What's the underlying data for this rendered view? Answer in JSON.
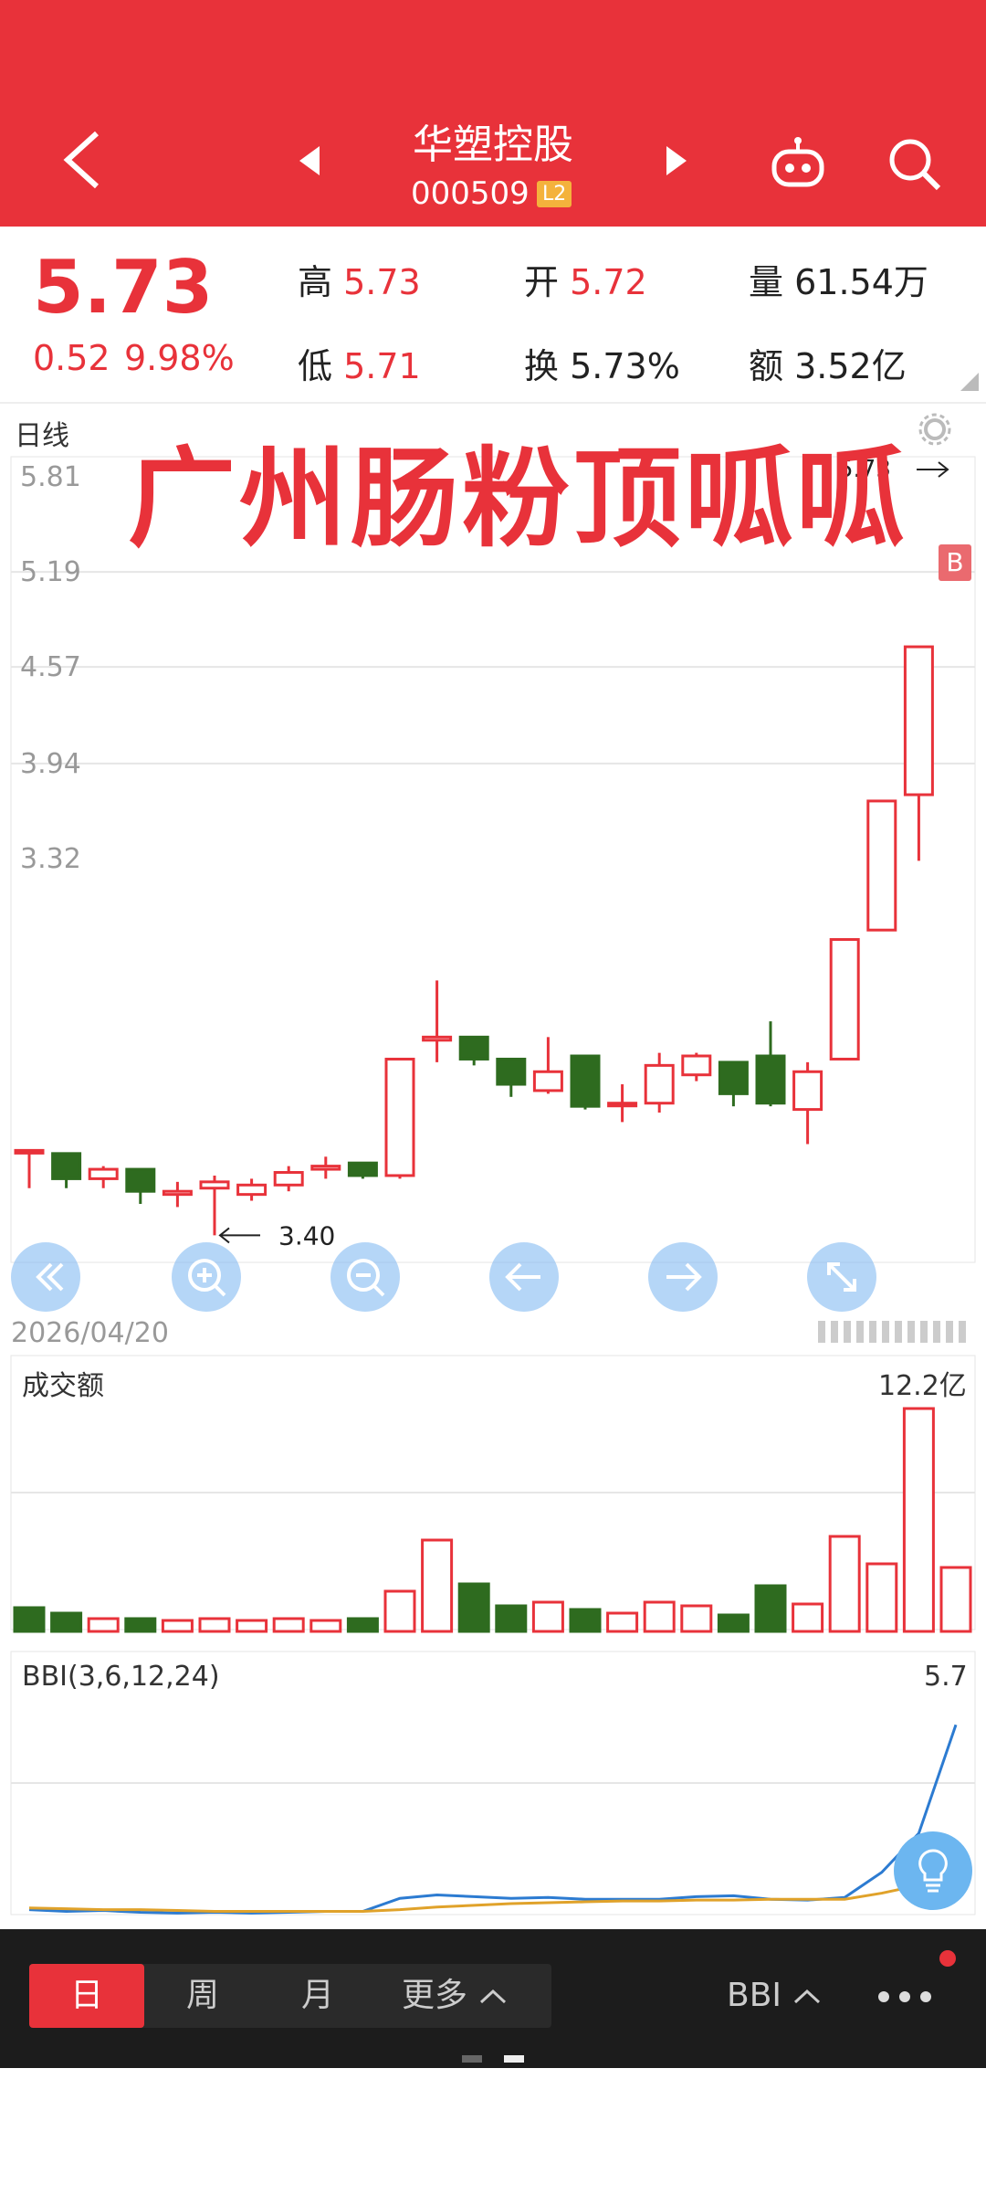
{
  "header": {
    "stock_name": "华塑控股",
    "stock_code": "000509",
    "level_badge": "L2",
    "icons": [
      "back-icon",
      "prev-icon",
      "next-icon",
      "robot-icon",
      "search-icon"
    ]
  },
  "quote": {
    "price": "5.73",
    "change": "0.52",
    "change_pct": "9.98%",
    "high_label": "高",
    "high": "5.73",
    "low_label": "低",
    "low": "5.71",
    "open_label": "开",
    "open": "5.72",
    "turnover_label": "换",
    "turnover": "5.73%",
    "volume_label": "量",
    "volume": "61.54万",
    "amount_label": "额",
    "amount": "3.52亿"
  },
  "kline": {
    "period_label": "日线",
    "overlay_text": "广州肠粉顶呱呱",
    "y_ticks": [
      "5.81",
      "5.19",
      "4.57",
      "3.94",
      "3.32"
    ],
    "max_marker": "5.73",
    "min_marker": "3.40",
    "date_label": "2026/04/20",
    "badge": "B"
  },
  "amount_panel": {
    "label": "成交额",
    "max_value": "12.2亿"
  },
  "bbi_panel": {
    "label": "BBI(3,6,12,24)",
    "value": "5.7"
  },
  "tabs": {
    "day": "日",
    "week": "周",
    "month": "月",
    "more": "更多",
    "indicator": "BBI"
  },
  "colors": {
    "up": "#e8323a",
    "down": "#2e6b1f",
    "bbi_line": "#2c7bd1",
    "ma_line": "#e0a22a"
  },
  "chart_data": [
    {
      "type": "candlestick",
      "title": "日线",
      "ylim": [
        3.32,
        5.81
      ],
      "candles": [
        {
          "o": 3.67,
          "h": 3.67,
          "l": 3.55,
          "c": 3.67
        },
        {
          "o": 3.66,
          "h": 3.66,
          "l": 3.55,
          "c": 3.58
        },
        {
          "o": 3.58,
          "h": 3.62,
          "l": 3.55,
          "c": 3.61
        },
        {
          "o": 3.61,
          "h": 3.61,
          "l": 3.5,
          "c": 3.54
        },
        {
          "o": 3.53,
          "h": 3.57,
          "l": 3.49,
          "c": 3.54
        },
        {
          "o": 3.55,
          "h": 3.59,
          "l": 3.4,
          "c": 3.57
        },
        {
          "o": 3.53,
          "h": 3.58,
          "l": 3.51,
          "c": 3.56
        },
        {
          "o": 3.56,
          "h": 3.62,
          "l": 3.54,
          "c": 3.6
        },
        {
          "o": 3.61,
          "h": 3.65,
          "l": 3.58,
          "c": 3.62
        },
        {
          "o": 3.63,
          "h": 3.63,
          "l": 3.58,
          "c": 3.59
        },
        {
          "o": 3.59,
          "h": 3.96,
          "l": 3.58,
          "c": 3.96
        },
        {
          "o": 4.02,
          "h": 4.21,
          "l": 3.95,
          "c": 4.03
        },
        {
          "o": 4.03,
          "h": 4.03,
          "l": 3.94,
          "c": 3.96
        },
        {
          "o": 3.96,
          "h": 3.96,
          "l": 3.84,
          "c": 3.88
        },
        {
          "o": 3.86,
          "h": 4.03,
          "l": 3.85,
          "c": 3.92
        },
        {
          "o": 3.97,
          "h": 3.97,
          "l": 3.8,
          "c": 3.81
        },
        {
          "o": 3.82,
          "h": 3.88,
          "l": 3.76,
          "c": 3.82
        },
        {
          "o": 3.82,
          "h": 3.98,
          "l": 3.79,
          "c": 3.94
        },
        {
          "o": 3.91,
          "h": 3.98,
          "l": 3.89,
          "c": 3.97
        },
        {
          "o": 3.95,
          "h": 3.95,
          "l": 3.81,
          "c": 3.85
        },
        {
          "o": 3.97,
          "h": 4.08,
          "l": 3.81,
          "c": 3.82
        },
        {
          "o": 3.8,
          "h": 3.95,
          "l": 3.69,
          "c": 3.92
        },
        {
          "o": 3.96,
          "h": 4.34,
          "l": 3.96,
          "c": 4.34
        },
        {
          "o": 4.37,
          "h": 4.78,
          "l": 4.37,
          "c": 4.78
        },
        {
          "o": 4.8,
          "h": 5.27,
          "l": 4.59,
          "c": 5.27
        }
      ]
    },
    {
      "type": "bar",
      "title": "成交额",
      "ylabel": "亿",
      "ylim": [
        0,
        12.2
      ],
      "values": [
        1.3,
        1.0,
        0.7,
        0.7,
        0.6,
        0.7,
        0.6,
        0.7,
        0.6,
        0.7,
        2.2,
        5.0,
        2.6,
        1.4,
        1.6,
        1.2,
        1.0,
        1.6,
        1.4,
        0.9,
        2.5,
        1.5,
        5.2,
        3.7,
        12.2,
        3.5
      ],
      "up": [
        false,
        false,
        true,
        false,
        true,
        true,
        true,
        true,
        true,
        false,
        true,
        true,
        false,
        false,
        true,
        false,
        true,
        true,
        true,
        false,
        false,
        true,
        true,
        true,
        true,
        true
      ]
    },
    {
      "type": "line",
      "title": "BBI(3,6,12,24)",
      "series": [
        {
          "values": [
            3.57,
            3.55,
            3.56,
            3.54,
            3.53,
            3.54,
            3.53,
            3.54,
            3.55,
            3.55,
            3.7,
            3.74,
            3.72,
            3.7,
            3.71,
            3.69,
            3.69,
            3.69,
            3.72,
            3.73,
            3.69,
            3.68,
            3.71,
            4.0,
            4.45,
            5.7
          ]
        },
        {
          "values": [
            3.59,
            3.58,
            3.57,
            3.57,
            3.56,
            3.55,
            3.55,
            3.55,
            3.55,
            3.55,
            3.57,
            3.6,
            3.62,
            3.64,
            3.65,
            3.66,
            3.67,
            3.67,
            3.68,
            3.68,
            3.69,
            3.69,
            3.69,
            3.76,
            3.85,
            4.05
          ]
        }
      ]
    }
  ]
}
